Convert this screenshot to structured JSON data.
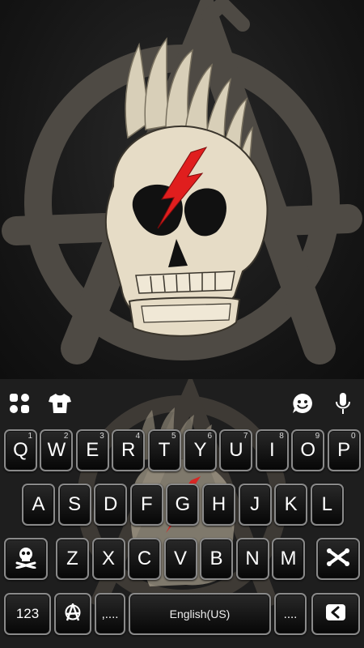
{
  "theme": {
    "accent": "#e01e1e",
    "key_border": "#8a8a8a",
    "bone": "#e8dcc4"
  },
  "toolbar": {
    "left": [
      {
        "icon": "apps-grid-icon"
      },
      {
        "icon": "tshirt-theme-icon"
      }
    ],
    "right": [
      {
        "icon": "emoji-face-icon"
      },
      {
        "icon": "microphone-icon"
      }
    ]
  },
  "rows": {
    "row1": [
      {
        "label": "Q",
        "hint": "1"
      },
      {
        "label": "W",
        "hint": "2"
      },
      {
        "label": "E",
        "hint": "3"
      },
      {
        "label": "R",
        "hint": "4"
      },
      {
        "label": "T",
        "hint": "5"
      },
      {
        "label": "Y",
        "hint": "6"
      },
      {
        "label": "U",
        "hint": "7"
      },
      {
        "label": "I",
        "hint": "8"
      },
      {
        "label": "O",
        "hint": "9"
      },
      {
        "label": "P",
        "hint": "0"
      }
    ],
    "row2": [
      {
        "label": "A"
      },
      {
        "label": "S"
      },
      {
        "label": "D"
      },
      {
        "label": "F"
      },
      {
        "label": "G"
      },
      {
        "label": "H"
      },
      {
        "label": "J"
      },
      {
        "label": "K"
      },
      {
        "label": "L"
      }
    ],
    "row3": [
      {
        "label": "Z"
      },
      {
        "label": "X"
      },
      {
        "label": "C"
      },
      {
        "label": "V"
      },
      {
        "label": "B"
      },
      {
        "label": "N"
      },
      {
        "label": "M"
      }
    ],
    "bottom": {
      "numbers": "123",
      "comma": ",....",
      "space": "English(US)",
      "period": "...."
    }
  },
  "icons": {
    "shift": "skull-crossbones-shift-icon",
    "delete": "crossbones-delete-icon",
    "symbols": "anarchy-symbol-icon",
    "enter": "back-arrow-enter-icon"
  }
}
